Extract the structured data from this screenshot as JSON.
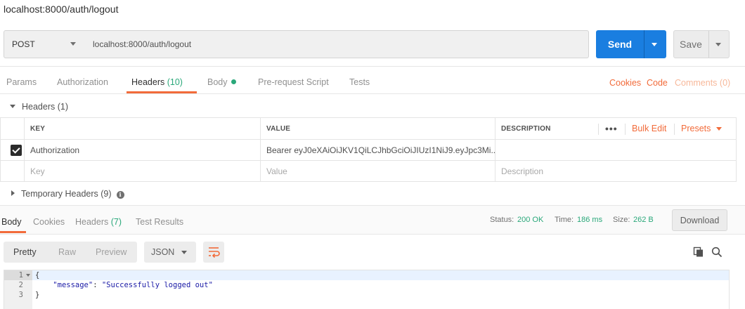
{
  "request": {
    "title": "localhost:8000/auth/logout",
    "method": "POST",
    "url": "localhost:8000/auth/logout",
    "send_label": "Send",
    "save_label": "Save"
  },
  "request_tabs": [
    {
      "label": "Params"
    },
    {
      "label": "Authorization"
    },
    {
      "label": "Headers",
      "count": "(10)"
    },
    {
      "label": "Body"
    },
    {
      "label": "Pre-request Script"
    },
    {
      "label": "Tests"
    }
  ],
  "request_links": {
    "cookies": "Cookies",
    "code": "Code",
    "comments": "Comments (0)"
  },
  "headers_section": {
    "title": "Headers (1)",
    "columns": {
      "key": "KEY",
      "value": "VALUE",
      "description": "DESCRIPTION"
    },
    "bulk_edit": "Bulk Edit",
    "presets": "Presets",
    "rows": [
      {
        "key": "Authorization",
        "value": "Bearer eyJ0eXAiOiJKV1QiLCJhbGciOiJIUzI1NiJ9.eyJpc3Mi...",
        "description": "",
        "checked": true
      }
    ],
    "placeholders": {
      "key": "Key",
      "value": "Value",
      "description": "Description"
    }
  },
  "temporary_headers": {
    "title": "Temporary Headers (9)"
  },
  "response": {
    "tabs": [
      {
        "label": "Body"
      },
      {
        "label": "Cookies"
      },
      {
        "label": "Headers",
        "count": "(7)"
      },
      {
        "label": "Test Results"
      }
    ],
    "status_label": "Status:",
    "status_value": "200 OK",
    "time_label": "Time:",
    "time_value": "186 ms",
    "size_label": "Size:",
    "size_value": "262 B",
    "download_label": "Download",
    "format_buttons": [
      "Pretty",
      "Raw",
      "Preview"
    ],
    "format_select": "JSON",
    "code_lines": [
      {
        "num": "1",
        "text": "{"
      },
      {
        "num": "2",
        "key": "\"message\"",
        "sep": ": ",
        "value": "\"Successfully logged out\""
      },
      {
        "num": "3",
        "text": "}"
      }
    ]
  },
  "colors": {
    "accent": "#f26b3a",
    "send": "#1a7ee0",
    "success": "#2aa87a"
  }
}
